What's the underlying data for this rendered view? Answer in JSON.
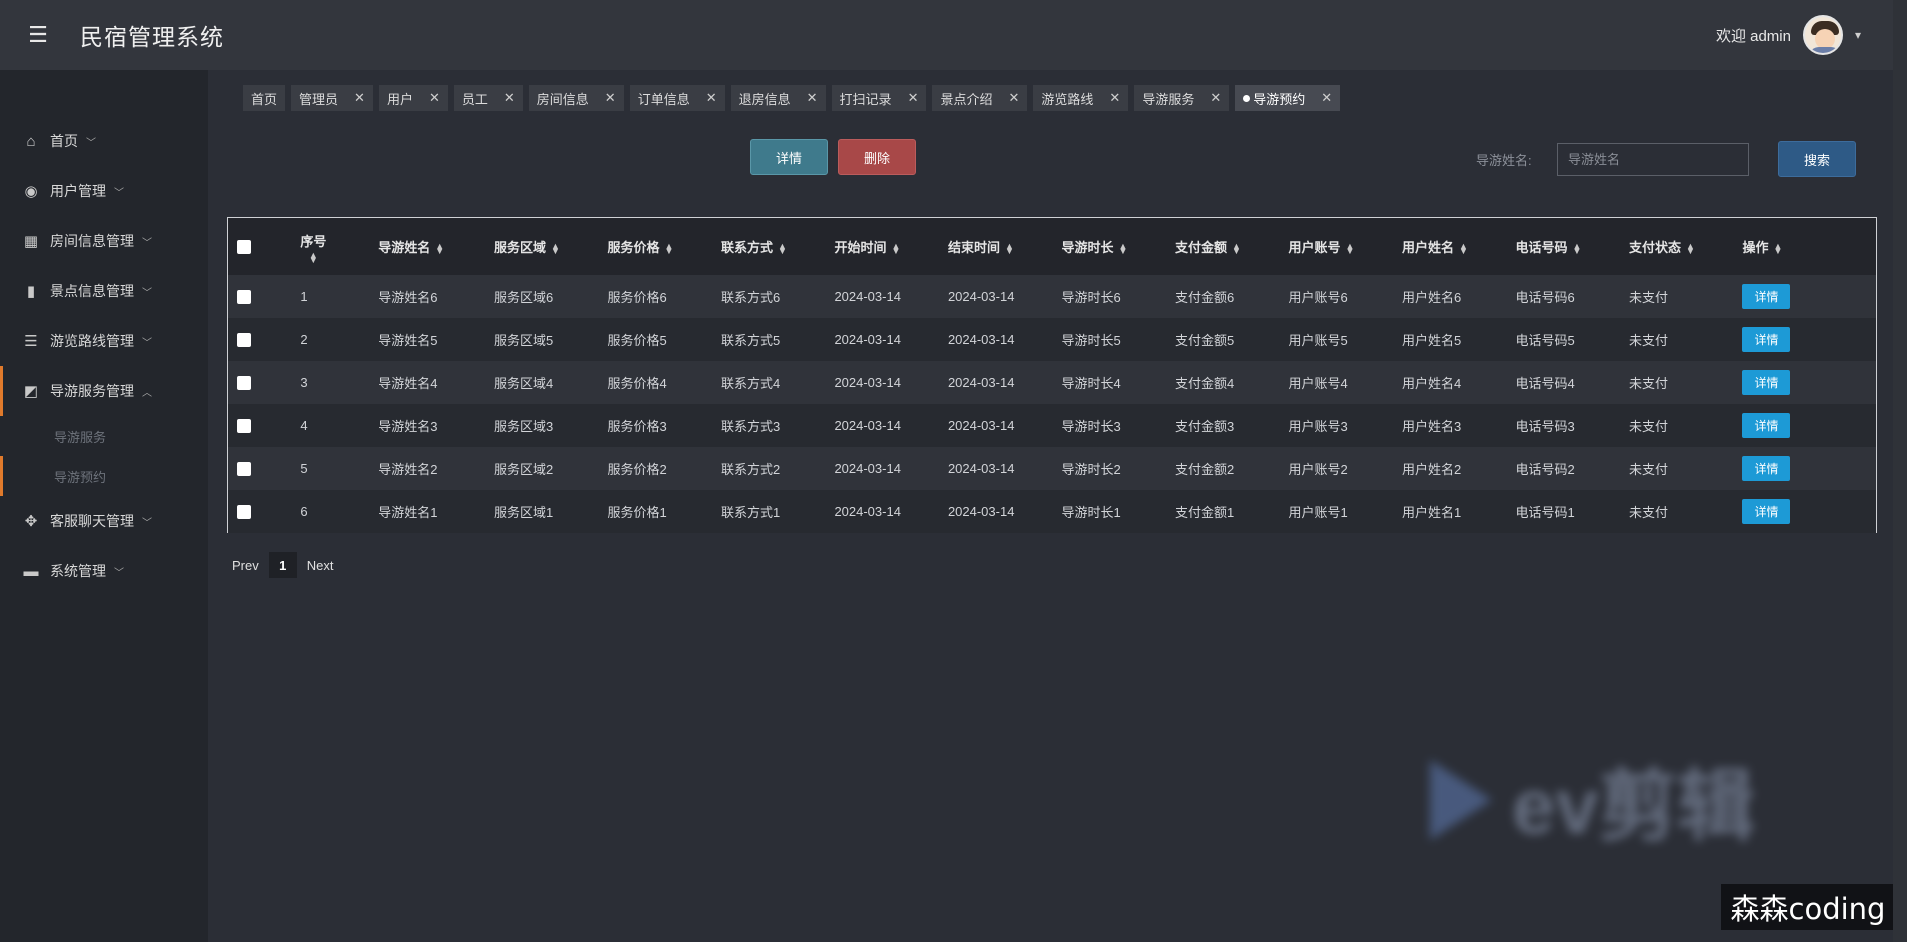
{
  "header": {
    "title": "民宿管理系统",
    "welcome": "欢迎 admin",
    "caret": "⌄"
  },
  "sidebar": {
    "items": [
      {
        "label": "首页",
        "icon": "home-icon",
        "glyph": "⌂"
      },
      {
        "label": "用户管理",
        "icon": "compass-icon",
        "glyph": "◉"
      },
      {
        "label": "房间信息管理",
        "icon": "store-icon",
        "glyph": "▦"
      },
      {
        "label": "景点信息管理",
        "icon": "book-icon",
        "glyph": "▮"
      },
      {
        "label": "游览路线管理",
        "icon": "server-icon",
        "glyph": "☰"
      },
      {
        "label": "导游服务管理",
        "icon": "chart-icon",
        "glyph": "◩"
      },
      {
        "label": "客服聊天管理",
        "icon": "apps-icon",
        "glyph": "✥"
      },
      {
        "label": "系统管理",
        "icon": "folder-icon",
        "glyph": "▬"
      }
    ],
    "sub": [
      "导游服务",
      "导游预约"
    ]
  },
  "tabs": [
    "首页",
    "管理员",
    "用户",
    "员工",
    "房间信息",
    "订单信息",
    "退房信息",
    "打扫记录",
    "景点介绍",
    "游览路线",
    "导游服务",
    "导游预约"
  ],
  "toolbar": {
    "detail_label": "详情",
    "delete_label": "删除",
    "search_label": "导游姓名:",
    "search_placeholder": "导游姓名",
    "search_button": "搜索"
  },
  "table": {
    "headers": [
      "序号",
      "导游姓名",
      "服务区域",
      "服务价格",
      "联系方式",
      "开始时间",
      "结束时间",
      "导游时长",
      "支付金额",
      "用户账号",
      "用户姓名",
      "电话号码",
      "支付状态",
      "操作"
    ],
    "rows": [
      [
        "1",
        "导游姓名6",
        "服务区域6",
        "服务价格6",
        "联系方式6",
        "2024-03-14",
        "2024-03-14",
        "导游时长6",
        "支付金额6",
        "用户账号6",
        "用户姓名6",
        "电话号码6",
        "未支付"
      ],
      [
        "2",
        "导游姓名5",
        "服务区域5",
        "服务价格5",
        "联系方式5",
        "2024-03-14",
        "2024-03-14",
        "导游时长5",
        "支付金额5",
        "用户账号5",
        "用户姓名5",
        "电话号码5",
        "未支付"
      ],
      [
        "3",
        "导游姓名4",
        "服务区域4",
        "服务价格4",
        "联系方式4",
        "2024-03-14",
        "2024-03-14",
        "导游时长4",
        "支付金额4",
        "用户账号4",
        "用户姓名4",
        "电话号码4",
        "未支付"
      ],
      [
        "4",
        "导游姓名3",
        "服务区域3",
        "服务价格3",
        "联系方式3",
        "2024-03-14",
        "2024-03-14",
        "导游时长3",
        "支付金额3",
        "用户账号3",
        "用户姓名3",
        "电话号码3",
        "未支付"
      ],
      [
        "5",
        "导游姓名2",
        "服务区域2",
        "服务价格2",
        "联系方式2",
        "2024-03-14",
        "2024-03-14",
        "导游时长2",
        "支付金额2",
        "用户账号2",
        "用户姓名2",
        "电话号码2",
        "未支付"
      ],
      [
        "6",
        "导游姓名1",
        "服务区域1",
        "服务价格1",
        "联系方式1",
        "2024-03-14",
        "2024-03-14",
        "导游时长1",
        "支付金额1",
        "用户账号1",
        "用户姓名1",
        "电话号码1",
        "未支付"
      ]
    ],
    "row_action": "详情"
  },
  "pagination": {
    "prev": "Prev",
    "current": "1",
    "next": "Next"
  },
  "watermark": {
    "logo_text": "ev剪辑",
    "caption": "森森coding"
  },
  "colors": {
    "accent": "#e07a2c",
    "detail_button": "#3f7a8c",
    "delete_button": "#a84848",
    "search_button": "#2e5a86",
    "row_action": "#1d9ad6"
  }
}
